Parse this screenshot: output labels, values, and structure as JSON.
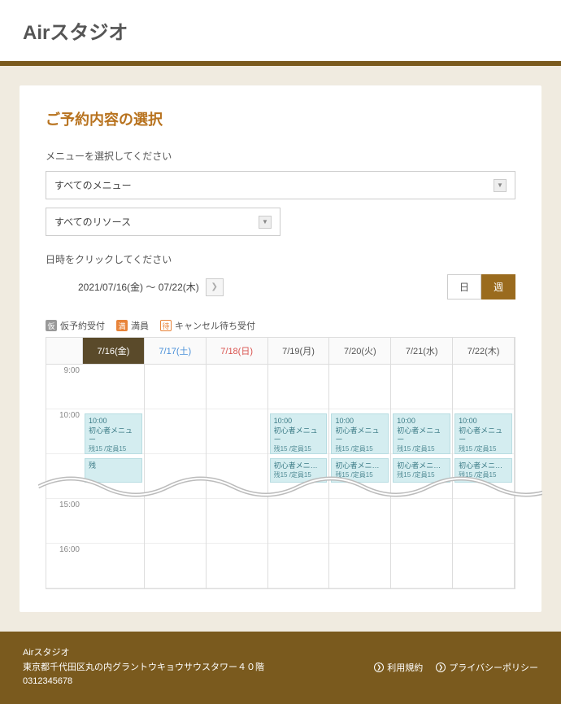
{
  "header": {
    "logo": "Airスタジオ"
  },
  "page": {
    "title": "ご予約内容の選択",
    "menu_label": "メニューを選択してください",
    "menu_select": "すべてのメニュー",
    "resource_select": "すべてのリソース",
    "date_label": "日時をクリックしてください",
    "date_range": "2021/07/16(金) 〜 07/22(木)",
    "view_day": "日",
    "view_week": "週"
  },
  "legend": {
    "tentative": "仮予約受付",
    "full": "満員",
    "waitlist": "キャンセル待ち受付",
    "badge_tentative": "仮",
    "badge_full": "満",
    "badge_wait": "待"
  },
  "calendar": {
    "days": [
      {
        "label": "7/16(金)",
        "cls": "today"
      },
      {
        "label": "7/17(土)",
        "cls": "sat"
      },
      {
        "label": "7/18(日)",
        "cls": "sun"
      },
      {
        "label": "7/19(月)",
        "cls": ""
      },
      {
        "label": "7/20(火)",
        "cls": ""
      },
      {
        "label": "7/21(水)",
        "cls": ""
      },
      {
        "label": "7/22(木)",
        "cls": ""
      }
    ],
    "times": [
      "9:00",
      "10:00",
      "",
      "15:00",
      "16:00"
    ],
    "event_time": "10:00",
    "event_name": "初心者メニュー",
    "event_cap": "残15 /定員15",
    "event2_name": "初心者メニ…",
    "event_cols": [
      0,
      3,
      4,
      5,
      6
    ],
    "event2_cols": [
      0,
      3,
      4,
      5,
      6
    ],
    "tag_11": "11"
  },
  "footer": {
    "name": "Airスタジオ",
    "address": "東京都千代田区丸の内グラントウキョウサウスタワー４０階",
    "phone": "0312345678",
    "terms": "利用規約",
    "privacy": "プライバシーポリシー"
  }
}
